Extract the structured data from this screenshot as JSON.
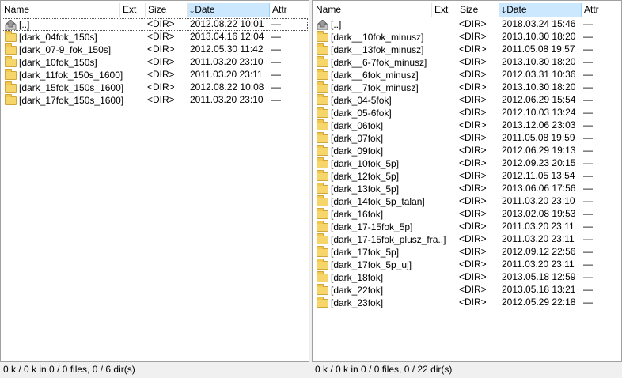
{
  "columns": {
    "name": "Name",
    "ext": "Ext",
    "size": "Size",
    "date": "Date",
    "attr": "Attr"
  },
  "left": {
    "rows": [
      {
        "name": "[..]",
        "size": "<DIR>",
        "date": "2012.08.22 10:01",
        "attr": "—",
        "icon": "up-arrow-icon"
      },
      {
        "name": "[dark_04fok_150s]",
        "size": "<DIR>",
        "date": "2013.04.16 12:04",
        "attr": "—",
        "icon": "folder-icon"
      },
      {
        "name": "[dark_07-9_fok_150s]",
        "size": "<DIR>",
        "date": "2012.05.30 11:42",
        "attr": "—",
        "icon": "folder-icon"
      },
      {
        "name": "[dark_10fok_150s]",
        "size": "<DIR>",
        "date": "2011.03.20 23:10",
        "attr": "—",
        "icon": "folder-icon"
      },
      {
        "name": "[dark_11fok_150s_1600]",
        "size": "<DIR>",
        "date": "2011.03.20 23:11",
        "attr": "—",
        "icon": "folder-icon"
      },
      {
        "name": "[dark_15fok_150s_1600]",
        "size": "<DIR>",
        "date": "2012.08.22 10:08",
        "attr": "—",
        "icon": "folder-icon"
      },
      {
        "name": "[dark_17fok_150s_1600]",
        "size": "<DIR>",
        "date": "2011.03.20 23:10",
        "attr": "—",
        "icon": "folder-icon"
      }
    ],
    "status": "0 k / 0 k in 0 / 0 files, 0 / 6 dir(s)"
  },
  "right": {
    "rows": [
      {
        "name": "[..]",
        "size": "<DIR>",
        "date": "2018.03.24 15:46",
        "attr": "—",
        "icon": "up-arrow-icon"
      },
      {
        "name": "[dark__10fok_minusz]",
        "size": "<DIR>",
        "date": "2013.10.30 18:20",
        "attr": "—",
        "icon": "folder-icon"
      },
      {
        "name": "[dark__13fok_minusz]",
        "size": "<DIR>",
        "date": "2011.05.08 19:57",
        "attr": "—",
        "icon": "folder-icon"
      },
      {
        "name": "[dark__6-7fok_minusz]",
        "size": "<DIR>",
        "date": "2013.10.30 18:20",
        "attr": "—",
        "icon": "folder-icon"
      },
      {
        "name": "[dark__6fok_minusz]",
        "size": "<DIR>",
        "date": "2012.03.31 10:36",
        "attr": "—",
        "icon": "folder-icon"
      },
      {
        "name": "[dark__7fok_minusz]",
        "size": "<DIR>",
        "date": "2013.10.30 18:20",
        "attr": "—",
        "icon": "folder-icon"
      },
      {
        "name": "[dark_04-5fok]",
        "size": "<DIR>",
        "date": "2012.06.29 15:54",
        "attr": "—",
        "icon": "folder-icon"
      },
      {
        "name": "[dark_05-6fok]",
        "size": "<DIR>",
        "date": "2012.10.03 13:24",
        "attr": "—",
        "icon": "folder-icon"
      },
      {
        "name": "[dark_06fok]",
        "size": "<DIR>",
        "date": "2013.12.06 23:03",
        "attr": "—",
        "icon": "folder-icon"
      },
      {
        "name": "[dark_07fok]",
        "size": "<DIR>",
        "date": "2011.05.08 19:59",
        "attr": "—",
        "icon": "folder-icon"
      },
      {
        "name": "[dark_09fok]",
        "size": "<DIR>",
        "date": "2012.06.29 19:13",
        "attr": "—",
        "icon": "folder-icon"
      },
      {
        "name": "[dark_10fok_5p]",
        "size": "<DIR>",
        "date": "2012.09.23 20:15",
        "attr": "—",
        "icon": "folder-icon"
      },
      {
        "name": "[dark_12fok_5p]",
        "size": "<DIR>",
        "date": "2012.11.05 13:54",
        "attr": "—",
        "icon": "folder-icon"
      },
      {
        "name": "[dark_13fok_5p]",
        "size": "<DIR>",
        "date": "2013.06.06 17:56",
        "attr": "—",
        "icon": "folder-icon"
      },
      {
        "name": "[dark_14fok_5p_talan]",
        "size": "<DIR>",
        "date": "2011.03.20 23:10",
        "attr": "—",
        "icon": "folder-icon"
      },
      {
        "name": "[dark_16fok]",
        "size": "<DIR>",
        "date": "2013.02.08 19:53",
        "attr": "—",
        "icon": "folder-icon"
      },
      {
        "name": "[dark_17-15fok_5p]",
        "size": "<DIR>",
        "date": "2011.03.20 23:11",
        "attr": "—",
        "icon": "folder-icon"
      },
      {
        "name": "[dark_17-15fok_plusz_fra..]",
        "size": "<DIR>",
        "date": "2011.03.20 23:11",
        "attr": "—",
        "icon": "folder-icon"
      },
      {
        "name": "[dark_17fok_5p]",
        "size": "<DIR>",
        "date": "2012.09.12 22:56",
        "attr": "—",
        "icon": "folder-icon"
      },
      {
        "name": "[dark_17fok_5p_uj]",
        "size": "<DIR>",
        "date": "2011.03.20 23:11",
        "attr": "—",
        "icon": "folder-icon"
      },
      {
        "name": "[dark_18fok]",
        "size": "<DIR>",
        "date": "2013.05.18 12:59",
        "attr": "—",
        "icon": "folder-icon"
      },
      {
        "name": "[dark_22fok]",
        "size": "<DIR>",
        "date": "2013.05.18 13:21",
        "attr": "—",
        "icon": "folder-icon"
      },
      {
        "name": "[dark_23fok]",
        "size": "<DIR>",
        "date": "2012.05.29 22:18",
        "attr": "—",
        "icon": "folder-icon"
      }
    ],
    "status": "0 k / 0 k in 0 / 0 files, 0 / 22 dir(s)"
  },
  "colors": {
    "sorted_header_bg": "#cce8ff",
    "folder_fill": "#f6d56a",
    "panel_bg": "#ffffff",
    "window_bg": "#f0f0f0"
  }
}
